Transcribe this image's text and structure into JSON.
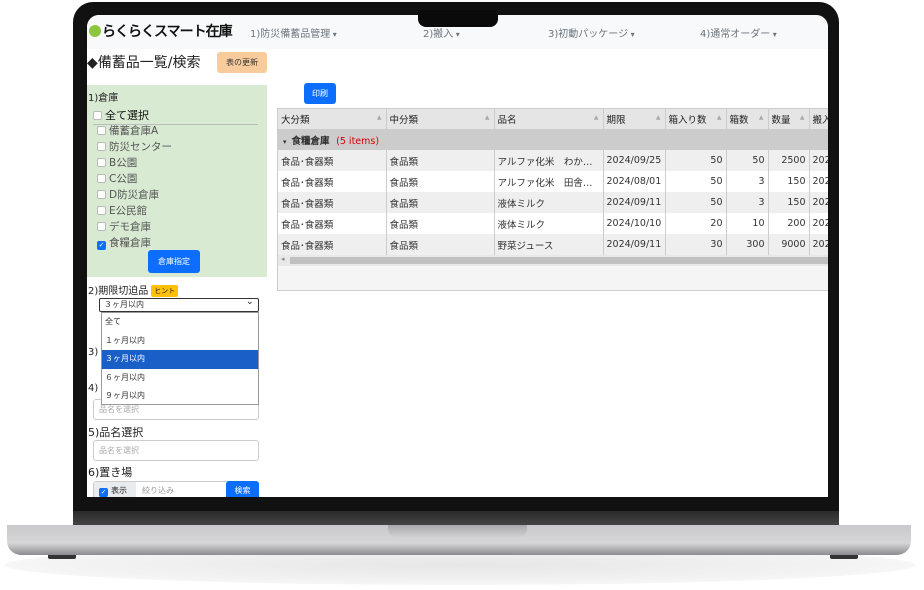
{
  "app": {
    "logo": "らくらくスマート在庫"
  },
  "nav": [
    "1)防災備蓄品管理",
    "2)搬入",
    "3)初動パッケージ",
    "4)通常オーダー"
  ],
  "page": {
    "title": "◆備蓄品一覧/検索",
    "refresh": "表の更新",
    "print": "印刷"
  },
  "warehouse": {
    "label": "1)倉庫",
    "select_all": "全て選択",
    "items": [
      {
        "name": "備蓄倉庫A",
        "checked": false
      },
      {
        "name": "防災センター",
        "checked": false
      },
      {
        "name": "B公園",
        "checked": false
      },
      {
        "name": "C公園",
        "checked": false
      },
      {
        "name": "D防災倉庫",
        "checked": false
      },
      {
        "name": "E公民館",
        "checked": false
      },
      {
        "name": "デモ倉庫",
        "checked": false
      },
      {
        "name": "食糧倉庫",
        "checked": true
      }
    ],
    "button": "倉庫指定"
  },
  "expiry": {
    "label": "2)期限切迫品",
    "hint": "ヒント",
    "selected": "３ヶ月以内",
    "options": [
      "全て",
      "１ヶ月以内",
      "３ヶ月以内",
      "６ヶ月以内",
      "９ヶ月以内"
    ]
  },
  "sec3": {
    "label": "3)"
  },
  "sec4": {
    "label": "4)",
    "placeholder": "品名を選択"
  },
  "sec5": {
    "label": "5)品名選択",
    "placeholder": "品名を選択"
  },
  "sec6": {
    "label": "6)置き場",
    "show": "表示",
    "filter_placeholder": "絞り込み",
    "search": "検索"
  },
  "table": {
    "columns": [
      "大分類",
      "中分類",
      "品名",
      "期限",
      "箱入り数",
      "箱数",
      "数量",
      "搬入"
    ],
    "group": {
      "name": "食糧倉庫",
      "count": "(5 items)"
    },
    "rows": [
      [
        "食品･食器類",
        "食品類",
        "アルファ化米　わかめご飯",
        "2024/09/25",
        "50",
        "50",
        "2500",
        "202"
      ],
      [
        "食品･食器類",
        "食品類",
        "アルファ化米　田舎ご飯",
        "2024/08/01",
        "50",
        "3",
        "150",
        "202"
      ],
      [
        "食品･食器類",
        "食品類",
        "液体ミルク",
        "2024/09/11",
        "50",
        "3",
        "150",
        "202"
      ],
      [
        "食品･食器類",
        "食品類",
        "液体ミルク",
        "2024/10/10",
        "20",
        "10",
        "200",
        "202"
      ],
      [
        "食品･食器類",
        "食品類",
        "野菜ジュース",
        "2024/09/11",
        "30",
        "300",
        "9000",
        "202"
      ]
    ]
  }
}
